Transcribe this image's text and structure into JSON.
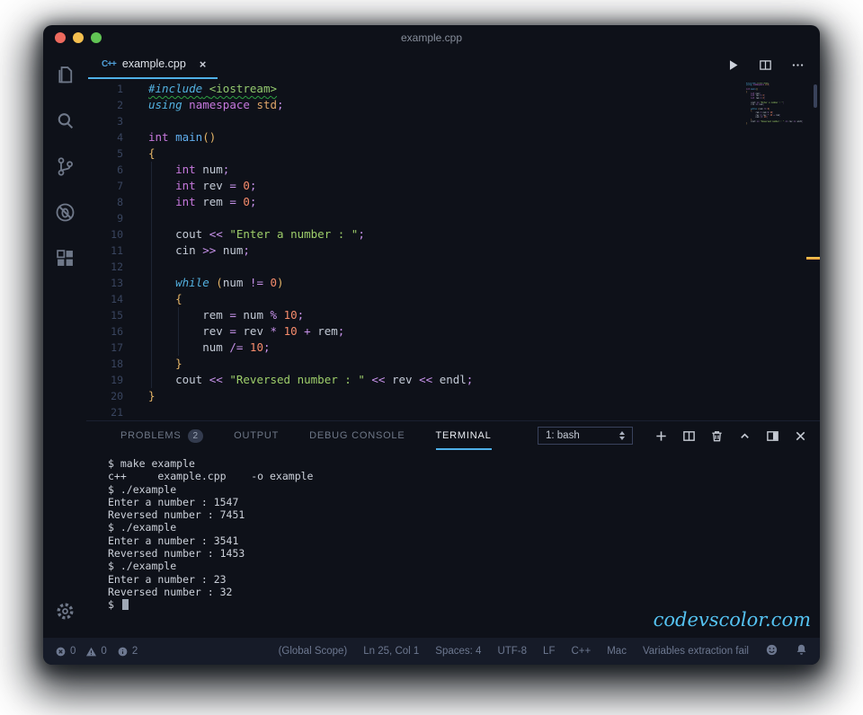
{
  "window": {
    "title": "example.cpp"
  },
  "traffic_lights": [
    {
      "name": "close",
      "color": "#ed6a5e"
    },
    {
      "name": "minimize",
      "color": "#f4bf4f"
    },
    {
      "name": "maximize",
      "color": "#61c454"
    }
  ],
  "tab": {
    "language_icon": "C++",
    "label": "example.cpp",
    "close": "×"
  },
  "editor": {
    "lines": [
      {
        "n": 1,
        "squiggle": true,
        "tokens": [
          {
            "t": "#include",
            "c": "ctl"
          },
          {
            "t": " ",
            "c": "fg"
          },
          {
            "t": "<iostream>",
            "c": "inc"
          }
        ]
      },
      {
        "n": 2,
        "tokens": [
          {
            "t": "using",
            "c": "ctl"
          },
          {
            "t": " ",
            "c": "fg"
          },
          {
            "t": "namespace",
            "c": "kw"
          },
          {
            "t": " ",
            "c": "fg"
          },
          {
            "t": "std",
            "c": "std"
          },
          {
            "t": ";",
            "c": "op"
          }
        ]
      },
      {
        "n": 3,
        "tokens": []
      },
      {
        "n": 4,
        "tokens": [
          {
            "t": "int",
            "c": "kw"
          },
          {
            "t": " ",
            "c": "fg"
          },
          {
            "t": "main",
            "c": "fn"
          },
          {
            "t": "()",
            "c": "br"
          }
        ]
      },
      {
        "n": 5,
        "tokens": [
          {
            "t": "{",
            "c": "br"
          }
        ]
      },
      {
        "n": 6,
        "tokens": [
          {
            "t": "    ",
            "c": "fg"
          },
          {
            "t": "int",
            "c": "kw"
          },
          {
            "t": " ",
            "c": "fg"
          },
          {
            "t": "num",
            "c": "fg"
          },
          {
            "t": ";",
            "c": "op"
          }
        ]
      },
      {
        "n": 7,
        "tokens": [
          {
            "t": "    ",
            "c": "fg"
          },
          {
            "t": "int",
            "c": "kw"
          },
          {
            "t": " ",
            "c": "fg"
          },
          {
            "t": "rev ",
            "c": "fg"
          },
          {
            "t": "=",
            "c": "op"
          },
          {
            "t": " ",
            "c": "fg"
          },
          {
            "t": "0",
            "c": "num"
          },
          {
            "t": ";",
            "c": "op"
          }
        ]
      },
      {
        "n": 8,
        "tokens": [
          {
            "t": "    ",
            "c": "fg"
          },
          {
            "t": "int",
            "c": "kw"
          },
          {
            "t": " ",
            "c": "fg"
          },
          {
            "t": "rem ",
            "c": "fg"
          },
          {
            "t": "=",
            "c": "op"
          },
          {
            "t": " ",
            "c": "fg"
          },
          {
            "t": "0",
            "c": "num"
          },
          {
            "t": ";",
            "c": "op"
          }
        ]
      },
      {
        "n": 9,
        "tokens": []
      },
      {
        "n": 10,
        "tokens": [
          {
            "t": "    ",
            "c": "fg"
          },
          {
            "t": "cout ",
            "c": "fg"
          },
          {
            "t": "<<",
            "c": "op"
          },
          {
            "t": " ",
            "c": "fg"
          },
          {
            "t": "\"Enter a number : \"",
            "c": "str"
          },
          {
            "t": ";",
            "c": "op"
          }
        ]
      },
      {
        "n": 11,
        "tokens": [
          {
            "t": "    ",
            "c": "fg"
          },
          {
            "t": "cin ",
            "c": "fg"
          },
          {
            "t": ">>",
            "c": "op"
          },
          {
            "t": " ",
            "c": "fg"
          },
          {
            "t": "num",
            "c": "fg"
          },
          {
            "t": ";",
            "c": "op"
          }
        ]
      },
      {
        "n": 12,
        "tokens": []
      },
      {
        "n": 13,
        "tokens": [
          {
            "t": "    ",
            "c": "fg"
          },
          {
            "t": "while",
            "c": "ctl"
          },
          {
            "t": " ",
            "c": "fg"
          },
          {
            "t": "(",
            "c": "br"
          },
          {
            "t": "num ",
            "c": "fg"
          },
          {
            "t": "!=",
            "c": "op"
          },
          {
            "t": " ",
            "c": "fg"
          },
          {
            "t": "0",
            "c": "num"
          },
          {
            "t": ")",
            "c": "br"
          }
        ]
      },
      {
        "n": 14,
        "tokens": [
          {
            "t": "    ",
            "c": "fg"
          },
          {
            "t": "{",
            "c": "br"
          }
        ]
      },
      {
        "n": 15,
        "tokens": [
          {
            "t": "        ",
            "c": "fg"
          },
          {
            "t": "rem ",
            "c": "fg"
          },
          {
            "t": "=",
            "c": "op"
          },
          {
            "t": " ",
            "c": "fg"
          },
          {
            "t": "num ",
            "c": "fg"
          },
          {
            "t": "%",
            "c": "op"
          },
          {
            "t": " ",
            "c": "fg"
          },
          {
            "t": "10",
            "c": "num"
          },
          {
            "t": ";",
            "c": "op"
          }
        ]
      },
      {
        "n": 16,
        "tokens": [
          {
            "t": "        ",
            "c": "fg"
          },
          {
            "t": "rev ",
            "c": "fg"
          },
          {
            "t": "=",
            "c": "op"
          },
          {
            "t": " ",
            "c": "fg"
          },
          {
            "t": "rev ",
            "c": "fg"
          },
          {
            "t": "*",
            "c": "op"
          },
          {
            "t": " ",
            "c": "fg"
          },
          {
            "t": "10",
            "c": "num"
          },
          {
            "t": " ",
            "c": "fg"
          },
          {
            "t": "+",
            "c": "op"
          },
          {
            "t": " ",
            "c": "fg"
          },
          {
            "t": "rem",
            "c": "fg"
          },
          {
            "t": ";",
            "c": "op"
          }
        ]
      },
      {
        "n": 17,
        "tokens": [
          {
            "t": "        ",
            "c": "fg"
          },
          {
            "t": "num ",
            "c": "fg"
          },
          {
            "t": "/=",
            "c": "op"
          },
          {
            "t": " ",
            "c": "fg"
          },
          {
            "t": "10",
            "c": "num"
          },
          {
            "t": ";",
            "c": "op"
          }
        ]
      },
      {
        "n": 18,
        "tokens": [
          {
            "t": "    ",
            "c": "fg"
          },
          {
            "t": "}",
            "c": "br"
          }
        ]
      },
      {
        "n": 19,
        "tokens": [
          {
            "t": "    ",
            "c": "fg"
          },
          {
            "t": "cout ",
            "c": "fg"
          },
          {
            "t": "<<",
            "c": "op"
          },
          {
            "t": " ",
            "c": "fg"
          },
          {
            "t": "\"Reversed number : \"",
            "c": "str"
          },
          {
            "t": " ",
            "c": "fg"
          },
          {
            "t": "<<",
            "c": "op"
          },
          {
            "t": " ",
            "c": "fg"
          },
          {
            "t": "rev ",
            "c": "fg"
          },
          {
            "t": "<<",
            "c": "op"
          },
          {
            "t": " ",
            "c": "fg"
          },
          {
            "t": "endl",
            "c": "fg"
          },
          {
            "t": ";",
            "c": "op"
          }
        ]
      },
      {
        "n": 20,
        "tokens": [
          {
            "t": "}",
            "c": "br"
          }
        ]
      },
      {
        "n": 21,
        "tokens": []
      }
    ]
  },
  "panel": {
    "tabs": [
      {
        "label": "PROBLEMS",
        "badge": "2",
        "active": false
      },
      {
        "label": "OUTPUT",
        "active": false
      },
      {
        "label": "DEBUG CONSOLE",
        "active": false
      },
      {
        "label": "TERMINAL",
        "active": true
      }
    ],
    "shell_selector": "1: bash"
  },
  "terminal": {
    "lines": [
      "$ make example",
      "c++     example.cpp    -o example",
      "$ ./example",
      "Enter a number : 1547",
      "Reversed number : 7451",
      "$ ./example",
      "Enter a number : 3541",
      "Reversed number : 1453",
      "$ ./example",
      "Enter a number : 23",
      "Reversed number : 32",
      "$ "
    ],
    "cursor": true,
    "watermark": "codevscolor.com"
  },
  "status_bar": {
    "problems": {
      "errors": "0",
      "warnings": "0",
      "infos": "2"
    },
    "items": [
      "(Global Scope)",
      "Ln 25, Col 1",
      "Spaces: 4",
      "UTF-8",
      "LF",
      "C++",
      "Mac",
      "Variables extraction fail"
    ]
  },
  "colors": {
    "accent": "#4fb0e8",
    "editor_bg": "#0e1119",
    "statusbar_bg": "#161b28",
    "squiggle": "#2ea043",
    "overview_mark": "#eda73e",
    "watermark": "#55c3f2"
  }
}
